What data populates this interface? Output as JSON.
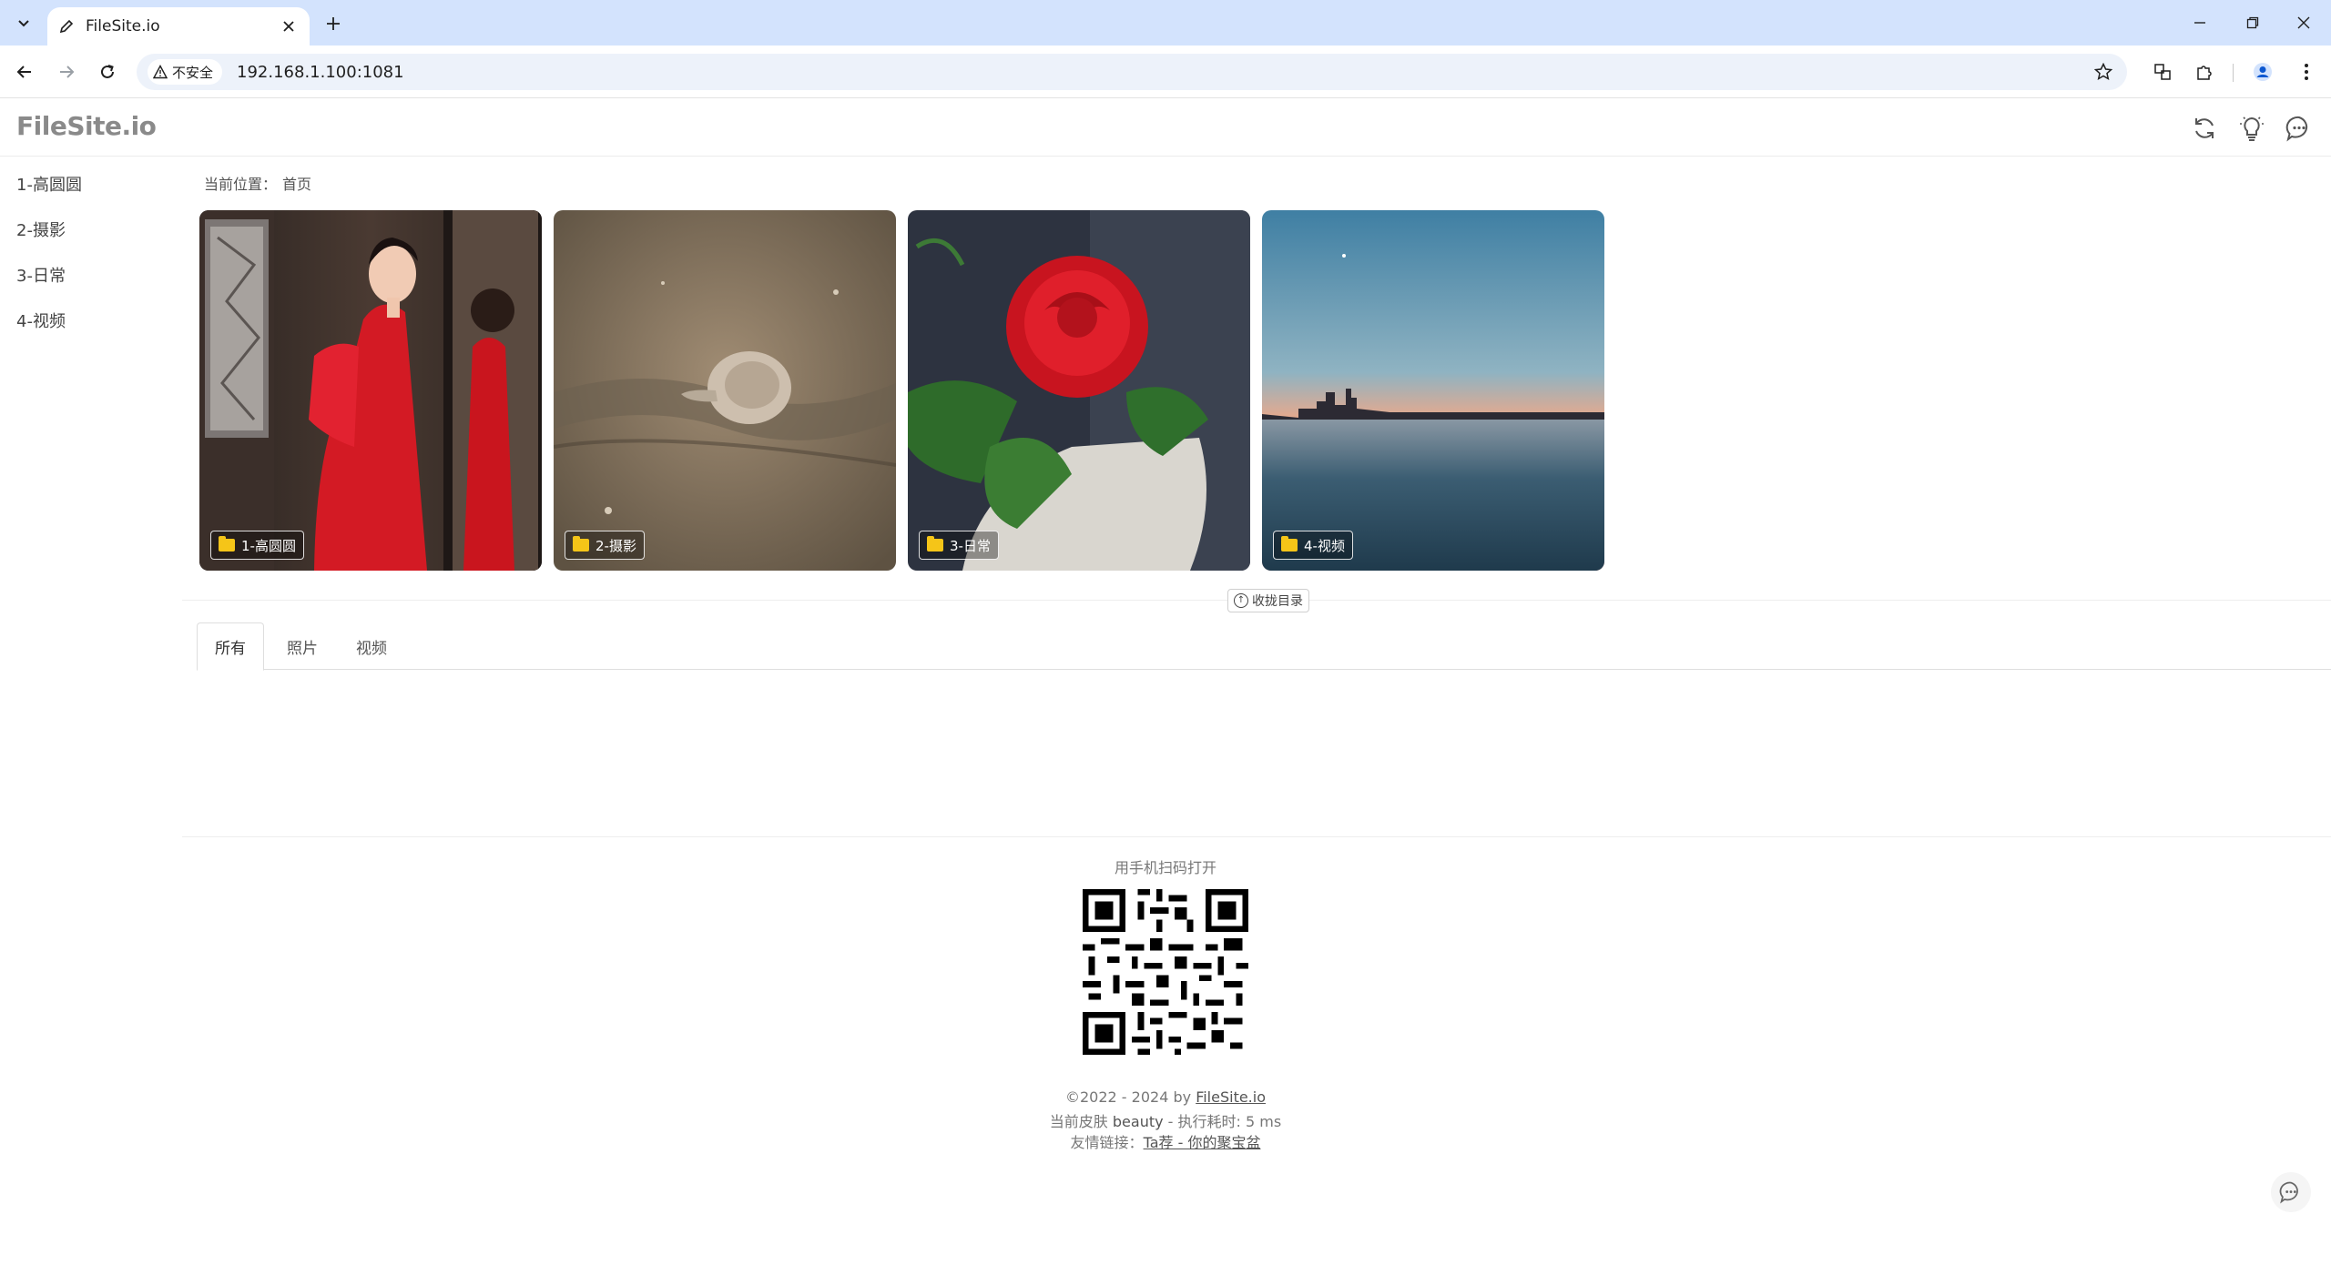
{
  "browser": {
    "tab_title": "FileSite.io",
    "security_label": "不安全",
    "url": "192.168.1.100:1081"
  },
  "site": {
    "logo": "FileSite.io"
  },
  "sidebar": {
    "items": [
      {
        "label": "1-高圆圆"
      },
      {
        "label": "2-摄影"
      },
      {
        "label": "3-日常"
      },
      {
        "label": "4-视频"
      }
    ]
  },
  "breadcrumb": {
    "prefix": "当前位置：",
    "home": "首页"
  },
  "folders": [
    {
      "label": "1-高圆圆"
    },
    {
      "label": "2-摄影"
    },
    {
      "label": "3-日常"
    },
    {
      "label": "4-视频"
    }
  ],
  "collapse_label": "收拢目录",
  "content_tabs": [
    {
      "label": "所有"
    },
    {
      "label": "照片"
    },
    {
      "label": "视频"
    }
  ],
  "footer": {
    "qr_caption": "用手机扫码打开",
    "copyright_prefix": "©2022 - 2024 by ",
    "copyright_link": "FileSite.io",
    "skin_prefix": "当前皮肤 ",
    "skin_name": "beauty",
    "skin_suffix": " - 执行耗时: 5 ms",
    "links_prefix": "友情链接：",
    "links_link": "Ta荐 - 你的聚宝盆"
  },
  "colors": {
    "tabbar": "#d3e3fd",
    "omnibox": "#edf2fa",
    "folder_icon": "#f5c518"
  }
}
